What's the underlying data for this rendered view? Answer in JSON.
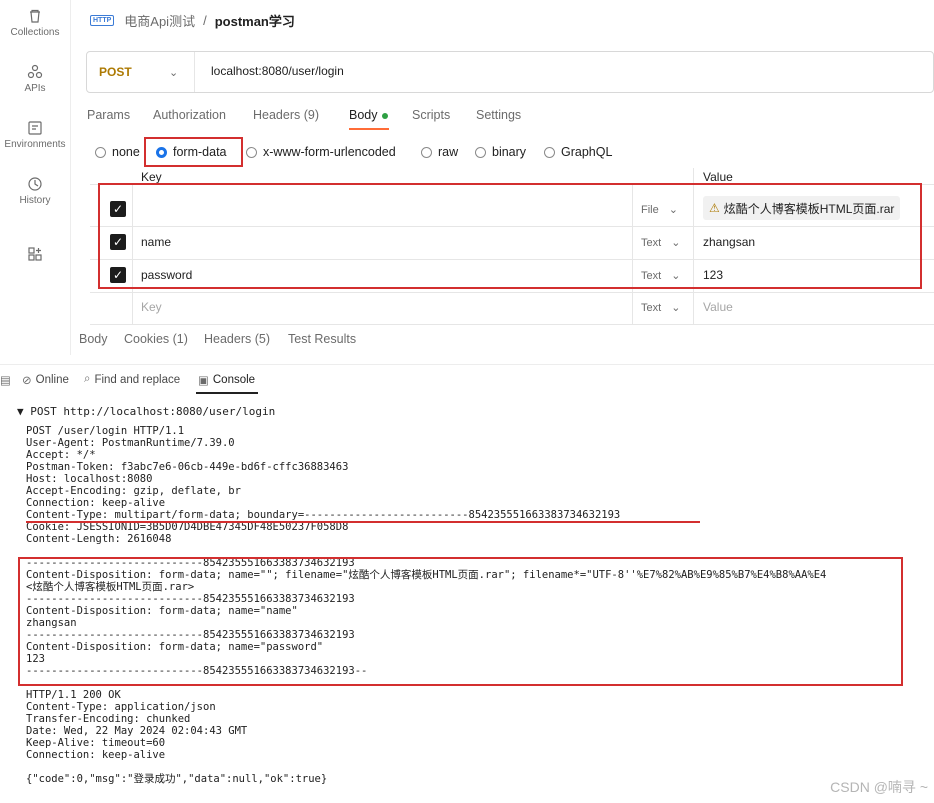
{
  "sidebar": {
    "items": [
      {
        "label": "Collections",
        "icon": "trash-icon"
      },
      {
        "label": "APIs",
        "icon": "apis-icon"
      },
      {
        "label": "Environments",
        "icon": "environments-icon"
      },
      {
        "label": "History",
        "icon": "history-icon"
      },
      {
        "label": "",
        "icon": "add-workspace-icon"
      }
    ]
  },
  "header": {
    "http_badge": "HTTP",
    "workspace": "电商Api测试",
    "separator": "/",
    "request_name": "postman学习"
  },
  "request": {
    "method": "POST",
    "url": "localhost:8080/user/login"
  },
  "tabs": [
    {
      "label": "Params"
    },
    {
      "label": "Authorization"
    },
    {
      "label": "Headers (9)"
    },
    {
      "label": "Body",
      "active": true
    },
    {
      "label": "Scripts"
    },
    {
      "label": "Settings"
    }
  ],
  "body_types": [
    {
      "label": "none",
      "selected": false
    },
    {
      "label": "form-data",
      "selected": true
    },
    {
      "label": "x-www-form-urlencoded",
      "selected": false
    },
    {
      "label": "raw",
      "selected": false
    },
    {
      "label": "binary",
      "selected": false
    },
    {
      "label": "GraphQL",
      "selected": false
    }
  ],
  "table": {
    "headers": {
      "key": "Key",
      "value": "Value"
    },
    "rows": [
      {
        "checked": true,
        "key": "",
        "type": "File",
        "value": "炫酷个人博客模板HTML页面.rar"
      },
      {
        "checked": true,
        "key": "name",
        "type": "Text",
        "value": "zhangsan"
      },
      {
        "checked": true,
        "key": "password",
        "type": "Text",
        "value": "123"
      },
      {
        "checked": false,
        "key": "Key",
        "type": "Text",
        "value": "Value",
        "placeholder": true
      }
    ]
  },
  "response_tabs": [
    {
      "label": "Body"
    },
    {
      "label": "Cookies (1)"
    },
    {
      "label": "Headers (5)"
    },
    {
      "label": "Test Results"
    }
  ],
  "console_bar": {
    "online": "Online",
    "find": "Find and replace",
    "console": "Console"
  },
  "console": {
    "request_line": "▼ POST http://localhost:8080/user/login",
    "request_headers": [
      "POST /user/login HTTP/1.1",
      "User-Agent: PostmanRuntime/7.39.0",
      "Accept: */*",
      "Postman-Token: f3abc7e6-06cb-449e-bd6f-cffc36883463",
      "Host: localhost:8080",
      "Accept-Encoding: gzip, deflate, br",
      "Connection: keep-alive",
      "Content-Type: multipart/form-data; boundary=--------------------------854235551663383734632193",
      "Cookie: JSESSIONID=3B5D07D4DBE47345DF48E50237F058D8",
      "Content-Length: 2616048"
    ],
    "body_lines": [
      "----------------------------854235551663383734632193",
      "Content-Disposition: form-data; name=\"\"; filename=\"炫酷个人博客模板HTML页面.rar\"; filename*=\"UTF-8''%E7%82%AB%E9%85%B7%E4%B8%AA%E4",
      "<炫酷个人博客模板HTML页面.rar>",
      "----------------------------854235551663383734632193",
      "Content-Disposition: form-data; name=\"name\"",
      "zhangsan",
      "----------------------------854235551663383734632193",
      "Content-Disposition: form-data; name=\"password\"",
      "123",
      "----------------------------854235551663383734632193--"
    ],
    "response_headers": [
      "HTTP/1.1 200 OK",
      "Content-Type: application/json",
      "Transfer-Encoding: chunked",
      "Date: Wed, 22 May 2024 02:04:43 GMT",
      "Keep-Alive: timeout=60",
      "Connection: keep-alive"
    ],
    "response_body": "{\"code\":0,\"msg\":\"登录成功\",\"data\":null,\"ok\":true}"
  },
  "watermark": "CSDN @喃寻 ~",
  "colors": {
    "accent": "#ff6c37",
    "highlight": "#d32f2f",
    "method": "#ad7a03",
    "selected_radio": "#1a73e8"
  }
}
